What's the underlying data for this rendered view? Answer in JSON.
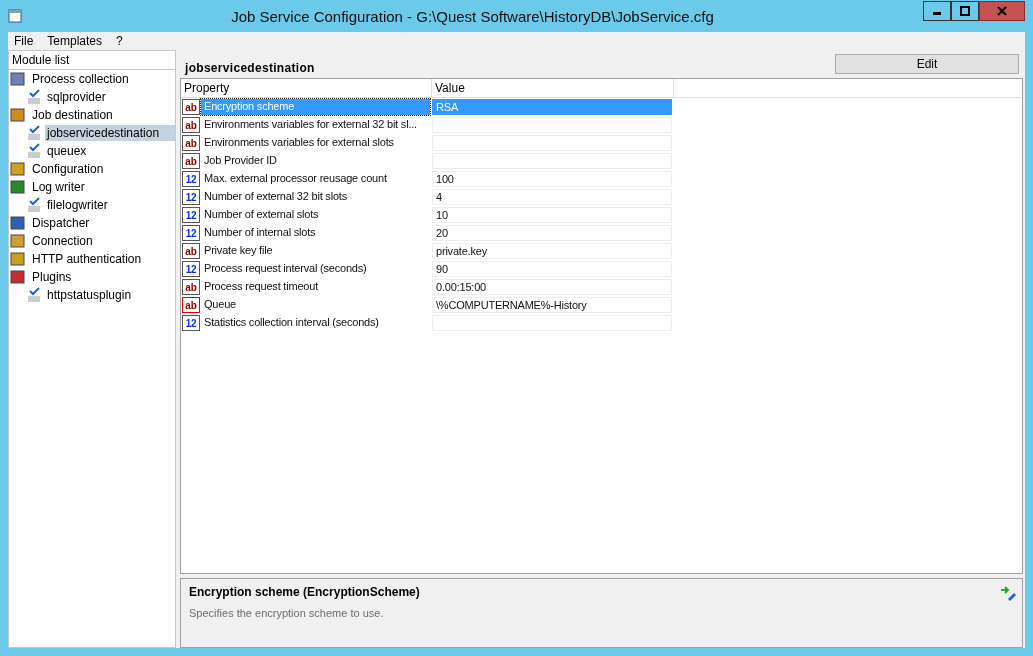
{
  "window": {
    "title": "Job Service Configuration - G:\\Quest Software\\HistoryDB\\JobService.cfg"
  },
  "menu": [
    "File",
    "Templates",
    "?"
  ],
  "module_list": {
    "header": "Module list",
    "items": [
      {
        "label": "Process collection",
        "selected": false,
        "children": [
          {
            "label": "sqlprovider",
            "selected": false
          }
        ]
      },
      {
        "label": "Job destination",
        "selected": false,
        "children": [
          {
            "label": "jobservicedestination",
            "selected": true
          },
          {
            "label": "queuex",
            "selected": false
          }
        ]
      },
      {
        "label": "Configuration",
        "selected": false
      },
      {
        "label": "Log writer",
        "selected": false,
        "children": [
          {
            "label": "filelogwriter",
            "selected": false
          }
        ]
      },
      {
        "label": "Dispatcher",
        "selected": false
      },
      {
        "label": "Connection",
        "selected": false
      },
      {
        "label": "HTTP authentication",
        "selected": false
      },
      {
        "label": "Plugins",
        "selected": false,
        "children": [
          {
            "label": "httpstatusplugin",
            "selected": false
          }
        ]
      }
    ]
  },
  "module_title": "jobservicedestination",
  "edit_button": "Edit",
  "grid": {
    "columns": [
      "Property",
      "Value"
    ],
    "rows": [
      {
        "kind": "text",
        "type_icon": "ab",
        "property": "Encryption scheme",
        "value": "RSA",
        "selected": true
      },
      {
        "kind": "text",
        "type_icon": "ab",
        "property": "Environments  variables  for  external  32  bit sl...",
        "value": "",
        "selected": false
      },
      {
        "kind": "text",
        "type_icon": "ab",
        "property": "Environments variables for external slots",
        "value": "",
        "selected": false
      },
      {
        "kind": "text",
        "type_icon": "ab",
        "property": "Job Provider ID",
        "value": "",
        "selected": false
      },
      {
        "kind": "number",
        "type_icon": "12",
        "property": "Max. external processor reusage count",
        "value": "100",
        "selected": false
      },
      {
        "kind": "number",
        "type_icon": "12",
        "property": "Number of external 32 bit slots",
        "value": "4",
        "selected": false
      },
      {
        "kind": "number",
        "type_icon": "12",
        "property": "Number of external slots",
        "value": "10",
        "selected": false
      },
      {
        "kind": "number",
        "type_icon": "12",
        "property": "Number of internal slots",
        "value": "20",
        "selected": false
      },
      {
        "kind": "text",
        "type_icon": "ab",
        "property": "Private key file",
        "value": "private.key",
        "selected": false
      },
      {
        "kind": "number",
        "type_icon": "12",
        "property": "Process request interval (seconds)",
        "value": "90",
        "selected": false
      },
      {
        "kind": "text",
        "type_icon": "ab",
        "property": "Process request timeout",
        "value": "0.00:15:00",
        "selected": false
      },
      {
        "kind": "required",
        "type_icon": "ab",
        "property": "Queue",
        "value": "\\%COMPUTERNAME%-History",
        "selected": false
      },
      {
        "kind": "number",
        "type_icon": "12",
        "property": "Statistics collection interval (seconds)",
        "value": "",
        "selected": false
      }
    ]
  },
  "description": {
    "title": "Encryption scheme (EncryptionScheme)",
    "text": "Specifies the encryption scheme to use."
  }
}
